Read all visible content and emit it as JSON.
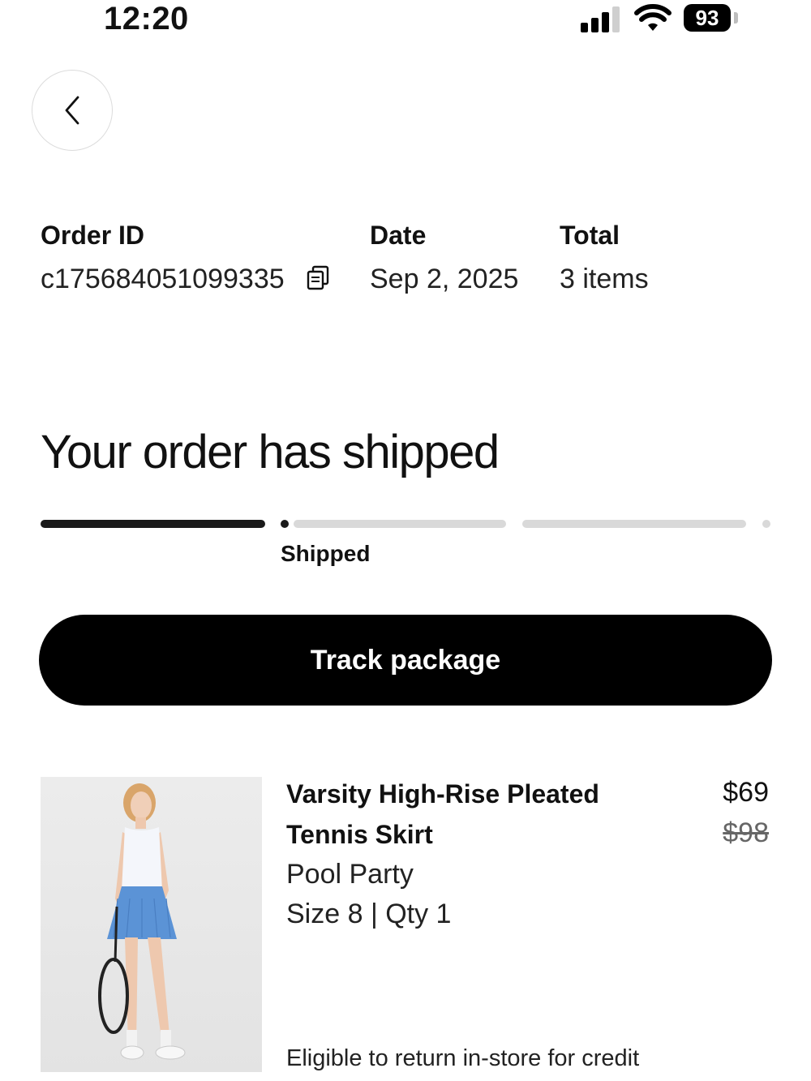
{
  "status_bar": {
    "time": "12:20",
    "battery": "93",
    "icons": [
      "signal-icon",
      "wifi-icon",
      "battery-icon"
    ]
  },
  "nav": {
    "back_icon": "chevron-left-icon"
  },
  "order": {
    "id_label": "Order ID",
    "id_value": "c175684051099335",
    "copy_icon": "copy-icon",
    "date_label": "Date",
    "date_value": "Sep 2, 2025",
    "total_label": "Total",
    "total_value": "3 items"
  },
  "status": {
    "headline": "Your order has shipped",
    "current_step_label": "Shipped",
    "steps_completed": 1,
    "steps_total": 3
  },
  "actions": {
    "track_label": "Track package"
  },
  "item": {
    "name": "Varsity High-Rise Pleated Tennis Skirt",
    "color": "Pool Party",
    "size_qty": "Size 8 | Qty 1",
    "price": "$69",
    "original_price": "$98",
    "return_note": "Eligible to return in-store for credit"
  },
  "colors": {
    "accent": "#000000",
    "progress_inactive": "#d9d9d9",
    "skirt": "#5b93d6"
  }
}
